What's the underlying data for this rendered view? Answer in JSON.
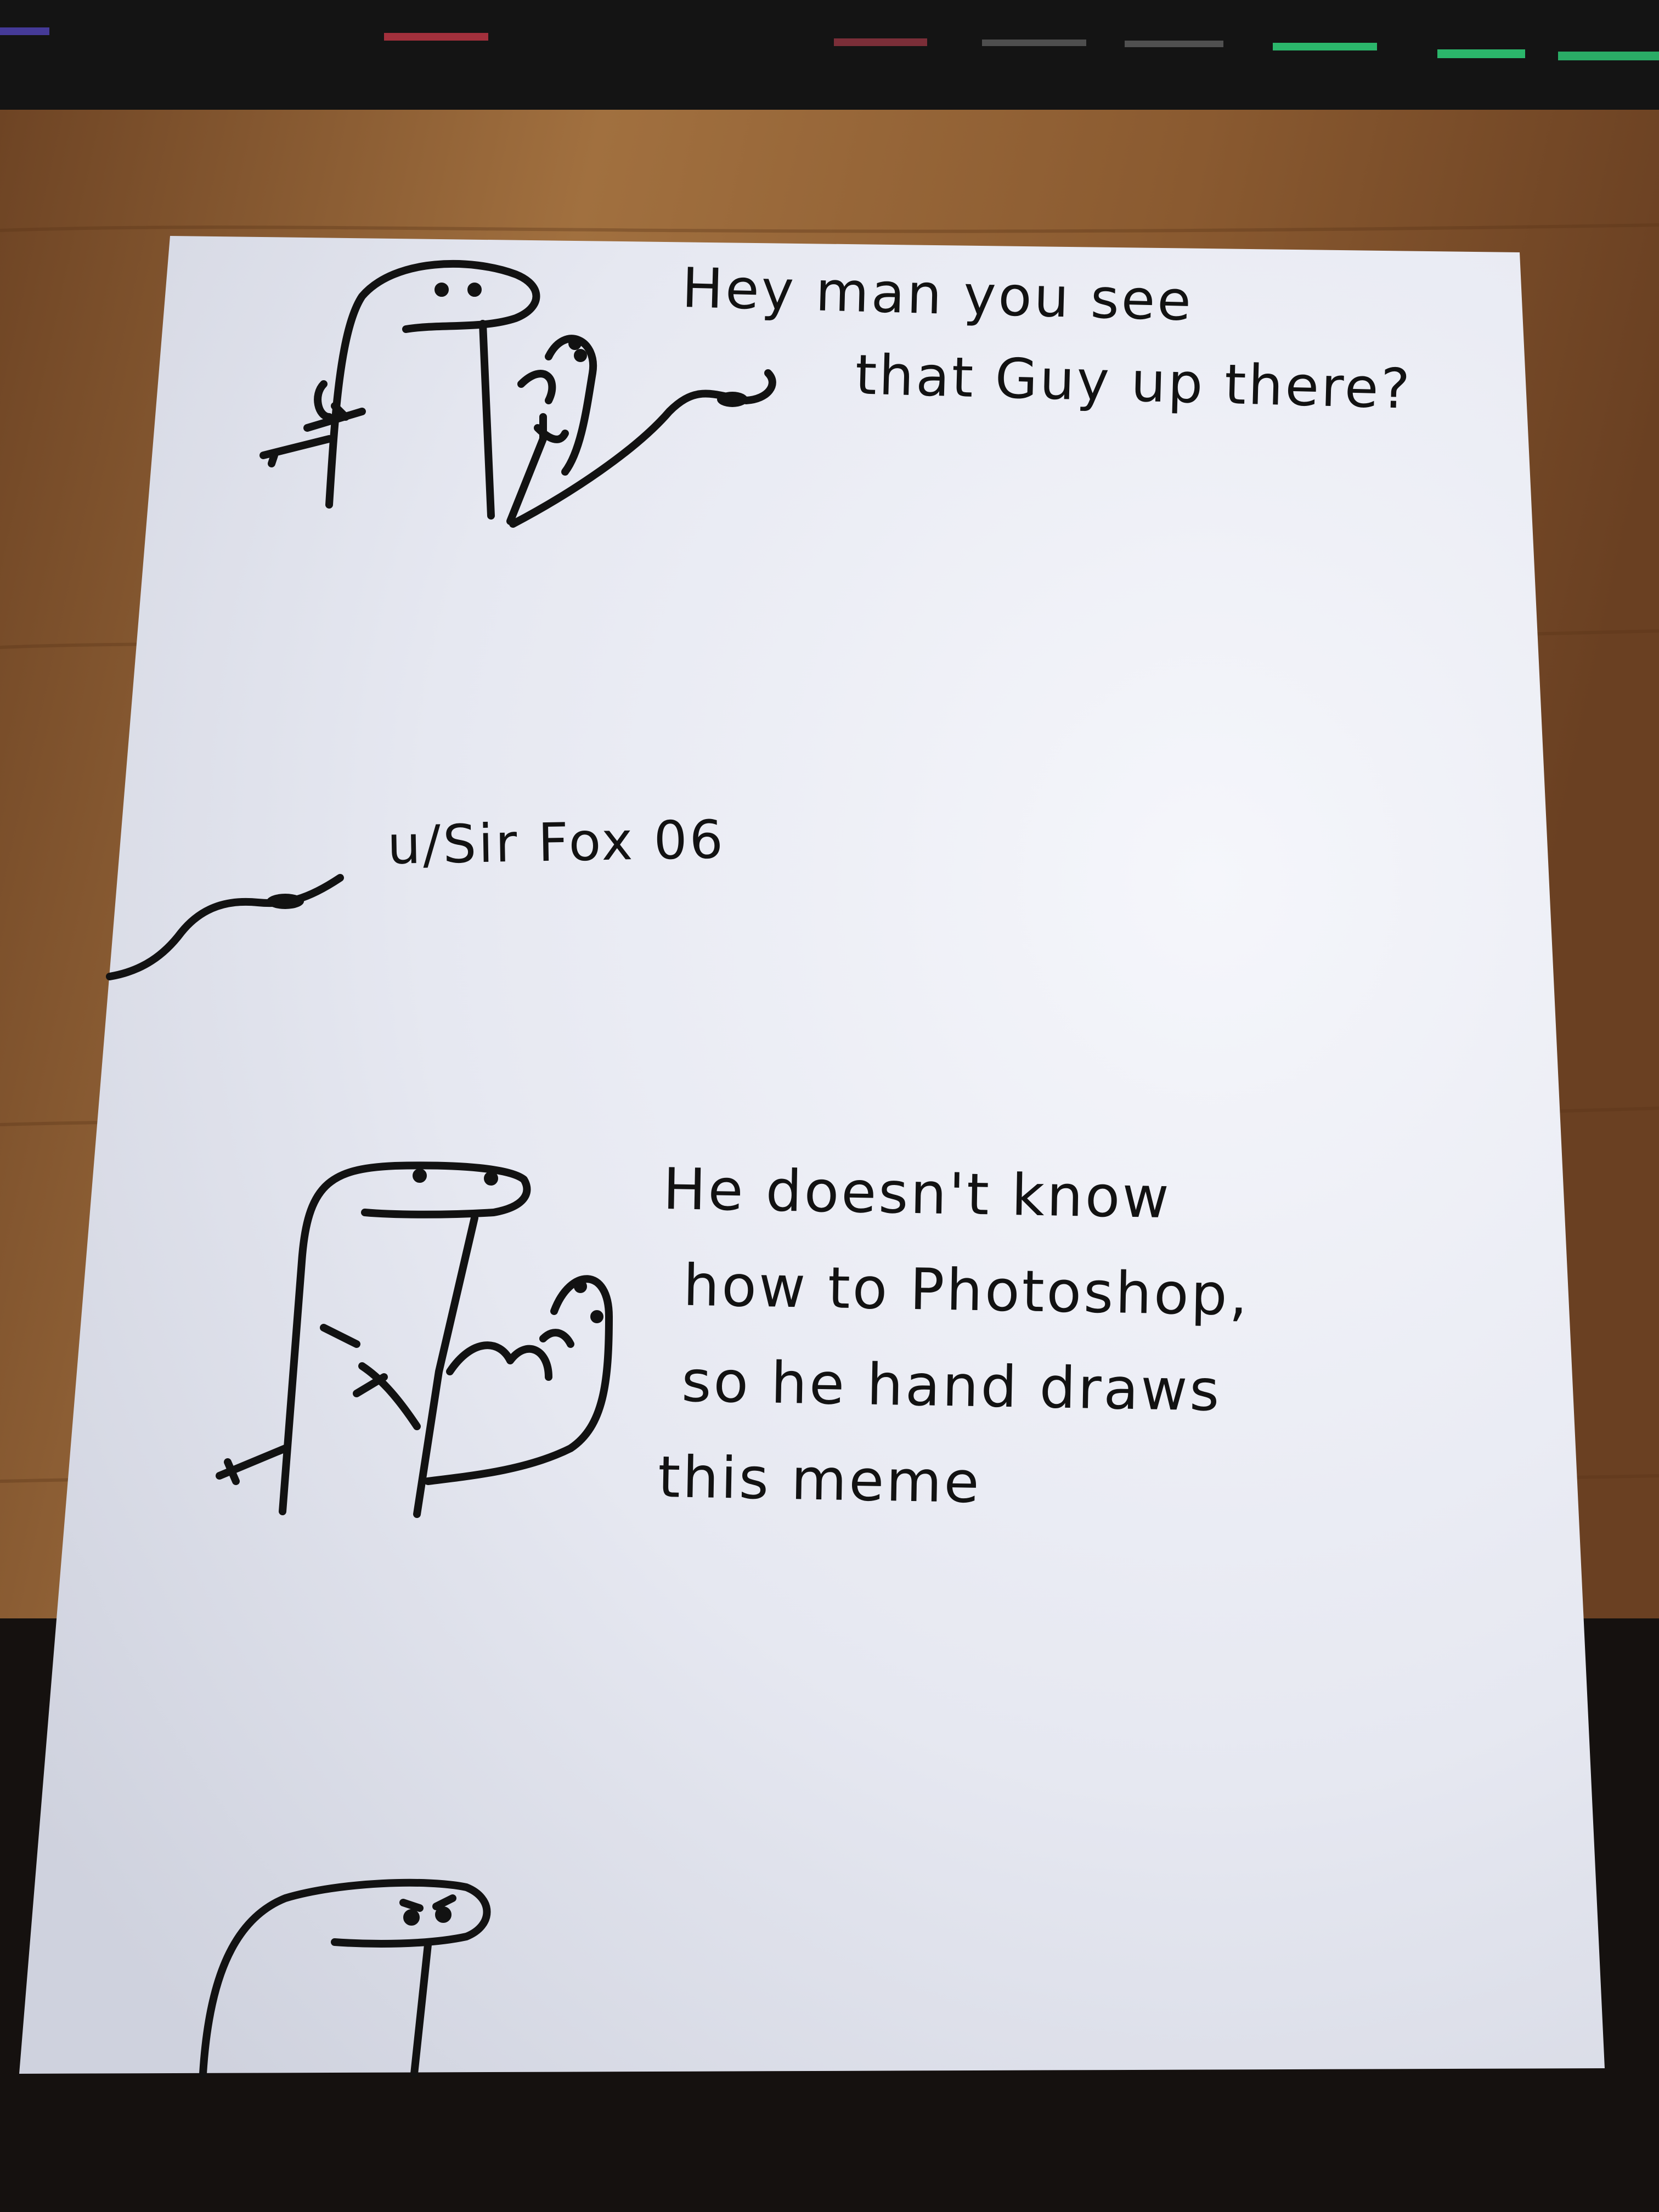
{
  "panel_top": {
    "caption_lines": [
      "Hey man you see",
      "that Guy up there?"
    ]
  },
  "signature": {
    "username": "u/Sir Fox 06"
  },
  "panel_middle": {
    "caption_lines": [
      "He doesn't know",
      "how to Photoshop,",
      "so he hand draws",
      "this meme"
    ]
  },
  "colors": {
    "desk_wood": "#9b6a3e",
    "paper": "#eceef6",
    "ink": "#121212",
    "keyboard": "#141414",
    "key_led_green": "#2fd27a",
    "key_led_red": "#d23a4a"
  }
}
